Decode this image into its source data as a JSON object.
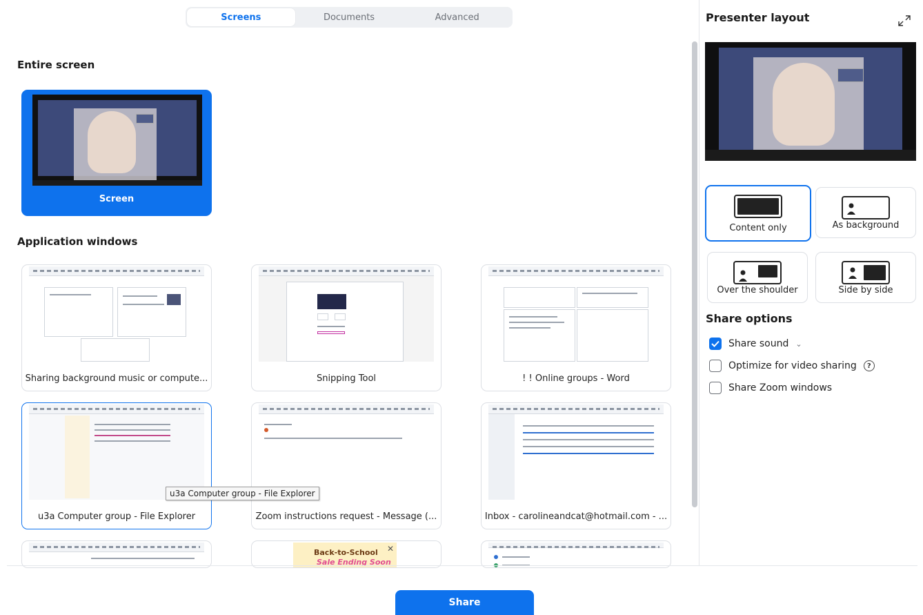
{
  "tabs": [
    {
      "label": "Screens",
      "active": true
    },
    {
      "label": "Documents",
      "active": false
    },
    {
      "label": "Advanced",
      "active": false
    }
  ],
  "sections": {
    "entire_screen": "Entire screen",
    "application_windows": "Application windows"
  },
  "screen_card": {
    "label": "Screen"
  },
  "app_windows": [
    {
      "label": "Sharing background music or compute..."
    },
    {
      "label": "Snipping Tool"
    },
    {
      "label": "! ! Online groups - Word"
    },
    {
      "label": "u3a Computer group - File Explorer"
    },
    {
      "label": "Zoom instructions request - Message (..."
    },
    {
      "label": "Inbox - carolineandcat@hotmail.com - ..."
    },
    {
      "label": ""
    },
    {
      "label": ""
    },
    {
      "label": ""
    }
  ],
  "tooltip": "u3a Computer group - File Explorer",
  "ad_thumb": {
    "line1": "Back-to-School",
    "line2": "Sale Ending Soon"
  },
  "share_button": "Share",
  "presenter_layout": {
    "title": "Presenter layout",
    "options": [
      {
        "label": "Content only",
        "selected": true
      },
      {
        "label": "As background",
        "selected": false
      },
      {
        "label": "Over the shoulder",
        "selected": false
      },
      {
        "label": "Side by side",
        "selected": false
      }
    ]
  },
  "share_options": {
    "title": "Share options",
    "items": [
      {
        "label": "Share sound",
        "checked": true
      },
      {
        "label": "Optimize for video sharing",
        "checked": false
      },
      {
        "label": "Share Zoom windows",
        "checked": false
      }
    ]
  },
  "colors": {
    "accent": "#0e72ed",
    "preview_bg": "#3d4a7a"
  }
}
